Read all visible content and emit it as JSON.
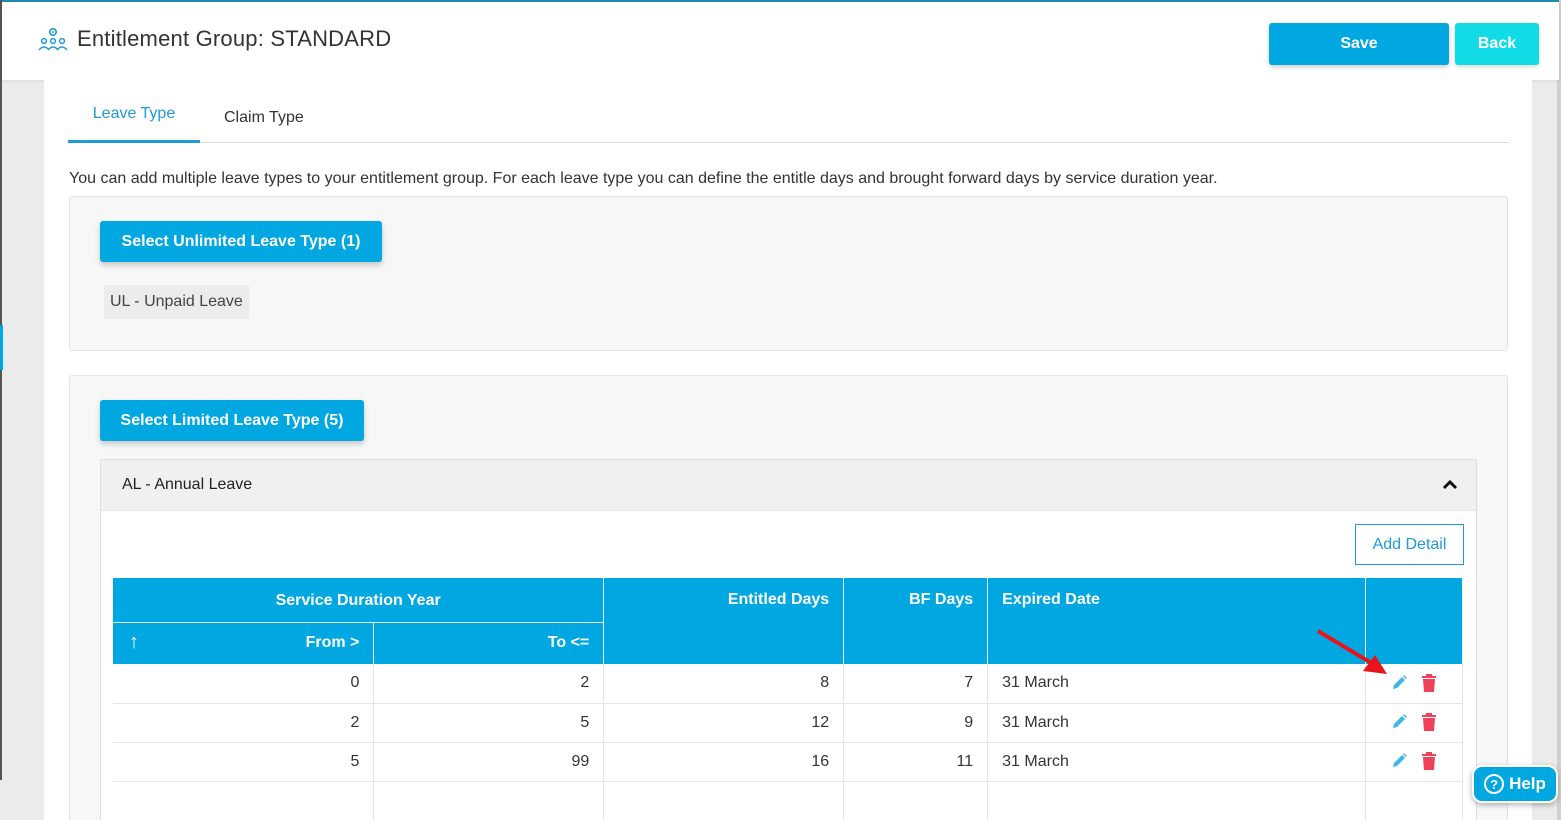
{
  "header": {
    "title": "Entitlement Group: STANDARD",
    "save_label": "Save",
    "back_label": "Back",
    "logo_icon": "group-settings-icon"
  },
  "tabs": [
    {
      "label": "Leave Type",
      "active": true
    },
    {
      "label": "Claim Type",
      "active": false
    }
  ],
  "description": "You can add multiple leave types to your entitlement group. For each leave type you can define the entitle days and brought forward days by service duration year.",
  "unlimited": {
    "button_label": "Select Unlimited Leave Type (1)",
    "items": [
      "UL - Unpaid Leave"
    ]
  },
  "limited": {
    "button_label": "Select Limited Leave Type (5)",
    "accordion_title": "AL - Annual Leave",
    "add_detail_label": "Add Detail",
    "table": {
      "group_header": "Service Duration Year",
      "headers": {
        "from": "From >",
        "to": "To <=",
        "entitled": "Entitled Days",
        "bf": "BF Days",
        "expired": "Expired Date",
        "sort_icon": "↑"
      },
      "rows": [
        {
          "from": "0",
          "to": "2",
          "entitled": "8",
          "bf": "7",
          "expired": "31 March"
        },
        {
          "from": "2",
          "to": "5",
          "entitled": "12",
          "bf": "9",
          "expired": "31 March"
        },
        {
          "from": "5",
          "to": "99",
          "entitled": "16",
          "bf": "11",
          "expired": "31 March"
        }
      ]
    }
  },
  "help": {
    "label": "Help",
    "icon": "?"
  },
  "colors": {
    "primary": "#00a7e1",
    "back": "#12dbe8",
    "delete": "#f0405a",
    "edit": "#3fb6e8",
    "arrow": "#e8141b"
  }
}
